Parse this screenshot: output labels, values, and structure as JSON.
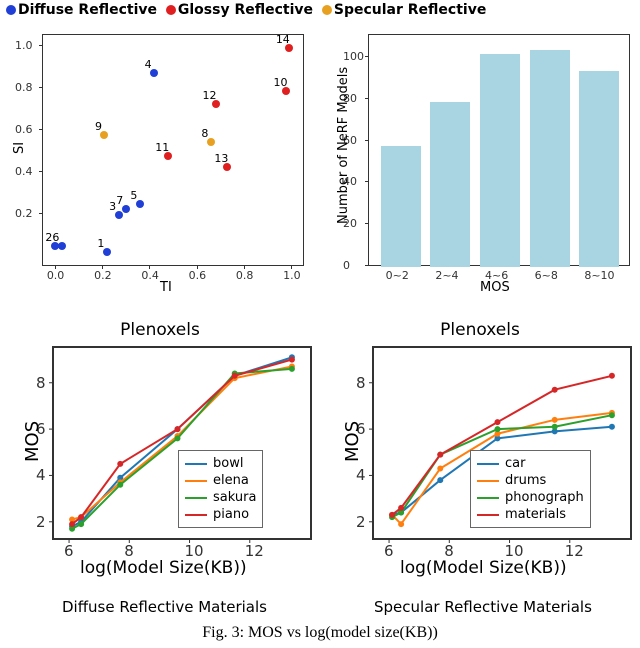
{
  "legend_top": {
    "diffuse": {
      "label": "Diffuse Reflective",
      "color": "#1f3fd6"
    },
    "glossy": {
      "label": "Glossy Reflective",
      "color": "#e02020"
    },
    "specular": {
      "label": "Specular Reflective",
      "color": "#e8a020"
    }
  },
  "scatter": {
    "xlabel": "TI",
    "ylabel": "SI",
    "xticks": [
      "0.0",
      "0.2",
      "0.4",
      "0.6",
      "0.8",
      "1.0"
    ],
    "yticks": [
      "0.2",
      "0.4",
      "0.6",
      "0.8",
      "1.0"
    ],
    "points": [
      {
        "id": "1",
        "x": 0.22,
        "y": 0.01,
        "cat": "diffuse"
      },
      {
        "id": "2",
        "x": 0.0,
        "y": 0.04,
        "cat": "diffuse"
      },
      {
        "id": "3",
        "x": 0.27,
        "y": 0.19,
        "cat": "diffuse"
      },
      {
        "id": "4",
        "x": 0.42,
        "y": 0.87,
        "cat": "diffuse"
      },
      {
        "id": "5",
        "x": 0.36,
        "y": 0.24,
        "cat": "diffuse"
      },
      {
        "id": "6",
        "x": 0.03,
        "y": 0.04,
        "cat": "diffuse"
      },
      {
        "id": "7",
        "x": 0.3,
        "y": 0.22,
        "cat": "diffuse"
      },
      {
        "id": "8",
        "x": 0.66,
        "y": 0.54,
        "cat": "specular"
      },
      {
        "id": "9",
        "x": 0.21,
        "y": 0.57,
        "cat": "specular"
      },
      {
        "id": "10",
        "x": 0.98,
        "y": 0.78,
        "cat": "glossy"
      },
      {
        "id": "11",
        "x": 0.48,
        "y": 0.47,
        "cat": "glossy"
      },
      {
        "id": "12",
        "x": 0.68,
        "y": 0.72,
        "cat": "glossy"
      },
      {
        "id": "13",
        "x": 0.73,
        "y": 0.42,
        "cat": "glossy"
      },
      {
        "id": "14",
        "x": 0.99,
        "y": 0.99,
        "cat": "glossy"
      }
    ]
  },
  "bar": {
    "ylabel": "Number of NeRF Models",
    "xlabel": "MOS",
    "xticks": [
      "0~2",
      "2~4",
      "4~6",
      "6~8",
      "8~10"
    ],
    "yticks": [
      "0",
      "20",
      "40",
      "60",
      "80",
      "100"
    ],
    "values": [
      57,
      78,
      101,
      103,
      93
    ]
  },
  "bottom_left": {
    "title": "Plenoxels",
    "subtitle": "Diffuse Reflective Materials",
    "xlabel": "log(Model Size(KB))",
    "ylabel": "MOS",
    "xticks": [
      "6",
      "8",
      "10",
      "12"
    ],
    "yticks": [
      "2",
      "4",
      "6",
      "8"
    ],
    "series": [
      {
        "name": "bowl",
        "color": "#1f77b4",
        "pts": [
          [
            6.1,
            1.8
          ],
          [
            6.4,
            2.0
          ],
          [
            7.7,
            3.9
          ],
          [
            9.6,
            6.0
          ],
          [
            11.5,
            8.3
          ],
          [
            13.4,
            9.1
          ]
        ]
      },
      {
        "name": "elena",
        "color": "#ff7f0e",
        "pts": [
          [
            6.1,
            2.1
          ],
          [
            6.4,
            2.2
          ],
          [
            7.7,
            3.7
          ],
          [
            9.6,
            5.7
          ],
          [
            11.5,
            8.2
          ],
          [
            13.4,
            8.7
          ]
        ]
      },
      {
        "name": "sakura",
        "color": "#2ca02c",
        "pts": [
          [
            6.1,
            1.7
          ],
          [
            6.4,
            1.9
          ],
          [
            7.7,
            3.6
          ],
          [
            9.6,
            5.6
          ],
          [
            11.5,
            8.4
          ],
          [
            13.4,
            8.6
          ]
        ]
      },
      {
        "name": "piano",
        "color": "#d62728",
        "pts": [
          [
            6.1,
            1.9
          ],
          [
            6.4,
            2.2
          ],
          [
            7.7,
            4.5
          ],
          [
            9.6,
            6.0
          ],
          [
            11.5,
            8.3
          ],
          [
            13.4,
            9.0
          ]
        ]
      }
    ]
  },
  "bottom_right": {
    "title": "Plenoxels",
    "subtitle": "Specular Reflective Materials",
    "xlabel": "log(Model Size(KB))",
    "ylabel": "MOS",
    "xticks": [
      "6",
      "8",
      "10",
      "12"
    ],
    "yticks": [
      "2",
      "4",
      "6",
      "8"
    ],
    "series": [
      {
        "name": "car",
        "color": "#1f77b4",
        "pts": [
          [
            6.1,
            2.3
          ],
          [
            6.4,
            2.4
          ],
          [
            7.7,
            3.8
          ],
          [
            9.6,
            5.6
          ],
          [
            11.5,
            5.9
          ],
          [
            13.4,
            6.1
          ]
        ]
      },
      {
        "name": "drums",
        "color": "#ff7f0e",
        "pts": [
          [
            6.1,
            2.3
          ],
          [
            6.4,
            1.9
          ],
          [
            7.7,
            4.3
          ],
          [
            9.6,
            5.8
          ],
          [
            11.5,
            6.4
          ],
          [
            13.4,
            6.7
          ]
        ]
      },
      {
        "name": "phonograph",
        "color": "#2ca02c",
        "pts": [
          [
            6.1,
            2.2
          ],
          [
            6.4,
            2.4
          ],
          [
            7.7,
            4.9
          ],
          [
            9.6,
            6.0
          ],
          [
            11.5,
            6.1
          ],
          [
            13.4,
            6.6
          ]
        ]
      },
      {
        "name": "materials",
        "color": "#d62728",
        "pts": [
          [
            6.1,
            2.3
          ],
          [
            6.4,
            2.6
          ],
          [
            7.7,
            4.9
          ],
          [
            9.6,
            6.3
          ],
          [
            11.5,
            7.7
          ],
          [
            13.4,
            8.3
          ]
        ]
      }
    ]
  },
  "caption": "Fig. 3: MOS vs log(model size(KB))",
  "chart_data": [
    {
      "type": "scatter",
      "title": "",
      "xlabel": "TI",
      "ylabel": "SI",
      "xlim": [
        0,
        1
      ],
      "ylim": [
        0,
        1
      ],
      "series": [
        {
          "name": "Diffuse Reflective",
          "points": [
            [
              0.22,
              0.01
            ],
            [
              0.0,
              0.04
            ],
            [
              0.27,
              0.19
            ],
            [
              0.42,
              0.87
            ],
            [
              0.36,
              0.24
            ],
            [
              0.03,
              0.04
            ],
            [
              0.3,
              0.22
            ]
          ]
        },
        {
          "name": "Glossy Reflective",
          "points": [
            [
              0.98,
              0.78
            ],
            [
              0.48,
              0.47
            ],
            [
              0.68,
              0.72
            ],
            [
              0.73,
              0.42
            ],
            [
              0.99,
              0.99
            ]
          ]
        },
        {
          "name": "Specular Reflective",
          "points": [
            [
              0.66,
              0.54
            ],
            [
              0.21,
              0.57
            ]
          ]
        }
      ]
    },
    {
      "type": "bar",
      "title": "",
      "xlabel": "MOS",
      "ylabel": "Number of NeRF Models",
      "ylim": [
        0,
        110
      ],
      "categories": [
        "0~2",
        "2~4",
        "4~6",
        "6~8",
        "8~10"
      ],
      "values": [
        57,
        78,
        101,
        103,
        93
      ]
    },
    {
      "type": "line",
      "title": "Plenoxels — Diffuse Reflective Materials",
      "xlabel": "log(Model Size(KB))",
      "ylabel": "MOS",
      "x": [
        6.1,
        6.4,
        7.7,
        9.6,
        11.5,
        13.4
      ],
      "series": [
        {
          "name": "bowl",
          "values": [
            1.8,
            2.0,
            3.9,
            6.0,
            8.3,
            9.1
          ]
        },
        {
          "name": "elena",
          "values": [
            2.1,
            2.2,
            3.7,
            5.7,
            8.2,
            8.7
          ]
        },
        {
          "name": "sakura",
          "values": [
            1.7,
            1.9,
            3.6,
            5.6,
            8.4,
            8.6
          ]
        },
        {
          "name": "piano",
          "values": [
            1.9,
            2.2,
            4.5,
            6.0,
            8.3,
            9.0
          ]
        }
      ]
    },
    {
      "type": "line",
      "title": "Plenoxels — Specular Reflective Materials",
      "xlabel": "log(Model Size(KB))",
      "ylabel": "MOS",
      "x": [
        6.1,
        6.4,
        7.7,
        9.6,
        11.5,
        13.4
      ],
      "series": [
        {
          "name": "car",
          "values": [
            2.3,
            2.4,
            3.8,
            5.6,
            5.9,
            6.1
          ]
        },
        {
          "name": "drums",
          "values": [
            2.3,
            1.9,
            4.3,
            5.8,
            6.4,
            6.7
          ]
        },
        {
          "name": "phonograph",
          "values": [
            2.2,
            2.4,
            4.9,
            6.0,
            6.1,
            6.6
          ]
        },
        {
          "name": "materials",
          "values": [
            2.3,
            2.6,
            4.9,
            6.3,
            7.7,
            8.3
          ]
        }
      ]
    }
  ]
}
